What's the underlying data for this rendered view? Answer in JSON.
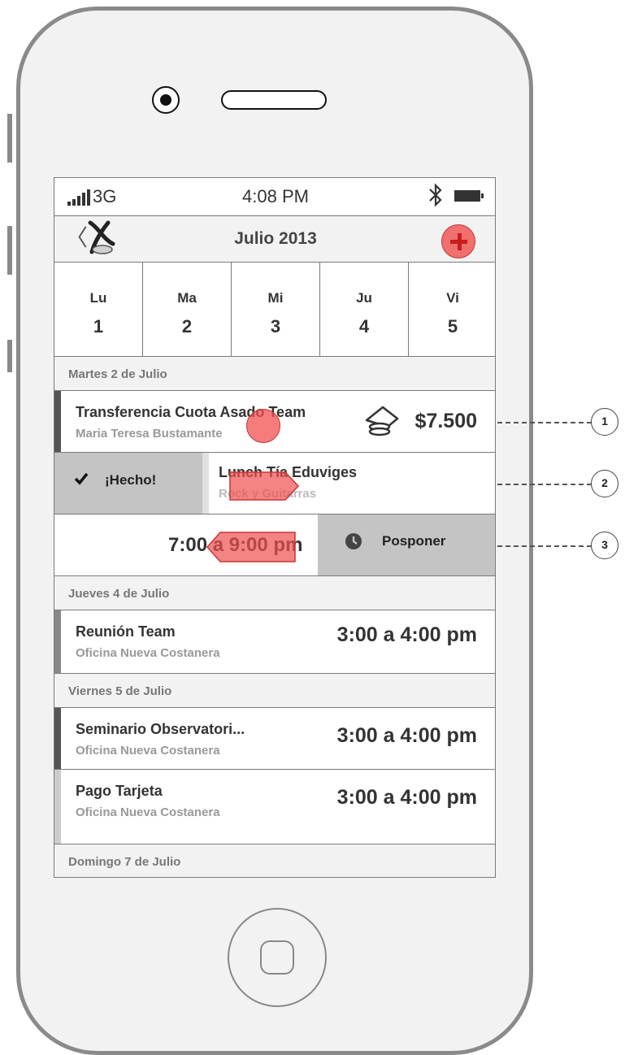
{
  "status": {
    "carrier": "3G",
    "time": "4:08 PM"
  },
  "nav": {
    "back": "〈",
    "title": "Julio 2013"
  },
  "week": [
    {
      "name": "Lu",
      "date": "1"
    },
    {
      "name": "Ma",
      "date": "2"
    },
    {
      "name": "Mi",
      "date": "3"
    },
    {
      "name": "Ju",
      "date": "4"
    },
    {
      "name": "Vi",
      "date": "5"
    }
  ],
  "sections": {
    "tuesday": "Martes 2 de Julio",
    "thursday": "Jueves 4 de Julio",
    "friday": "Viernes 5 de Julio",
    "sunday": "Domingo 7 de Julio"
  },
  "events": {
    "transfer": {
      "title": "Transferencia Cuota Asado Team",
      "subtitle": "Maria Teresa Bustamante",
      "amount": "$7.500",
      "color": "#555555"
    },
    "lunch": {
      "done_label": "¡Hecho!",
      "title": "Lunch Tía Eduviges",
      "subtitle": "Rock y Guitarras"
    },
    "lunch_time": {
      "time": "7:00 a 9:00 pm",
      "postpone_label": "Posponer"
    },
    "meeting": {
      "title": "Reunión Team",
      "subtitle": "Oficina Nueva Costanera",
      "time": "3:00 a 4:00 pm",
      "color": "#888888"
    },
    "seminar": {
      "title": "Seminario Observatori...",
      "subtitle": "Oficina Nueva Costanera",
      "time": "3:00 a 4:00 pm",
      "color": "#555555"
    },
    "payment": {
      "title": "Pago Tarjeta",
      "subtitle": "Oficina Nueva Costanera",
      "time": "3:00 a 4:00 pm",
      "color": "#cccccc"
    }
  },
  "annotations": [
    "1",
    "2",
    "3"
  ],
  "colors": {
    "accent": "#f07070",
    "accent_dark": "#c81e1e",
    "action_bg": "#c4c4c4"
  },
  "icons": [
    "signal-icon",
    "bluetooth-icon",
    "battery-icon",
    "back-icon",
    "app-logo-icon",
    "add-icon",
    "coins-icon",
    "check-icon",
    "clock-icon"
  ]
}
